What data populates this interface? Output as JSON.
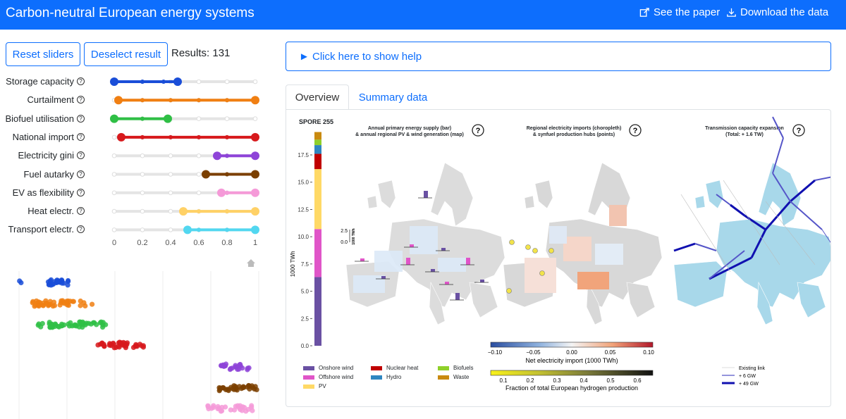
{
  "header": {
    "title": "Carbon-neutral European energy systems",
    "see_paper": "See the paper",
    "download": "Download the data"
  },
  "controls": {
    "reset_label": "Reset sliders",
    "deselect_label": "Deselect result",
    "results_text": "Results: 131"
  },
  "sliders": [
    {
      "label": "Storage capacity",
      "min": 0.0,
      "max": 0.45,
      "color": "#1a4ed8",
      "dots": [
        0,
        0.2,
        0.35
      ]
    },
    {
      "label": "Curtailment",
      "min": 0.03,
      "max": 1.0,
      "color": "#f07f12",
      "dots": [
        0.2,
        0.4,
        0.6,
        0.8
      ]
    },
    {
      "label": "Biofuel utilisation",
      "min": 0.0,
      "max": 0.38,
      "color": "#2fbf45",
      "dots": [
        0.2
      ]
    },
    {
      "label": "National import",
      "min": 0.05,
      "max": 1.0,
      "color": "#d7191c",
      "dots": [
        0.2,
        0.4,
        0.6,
        0.8
      ]
    },
    {
      "label": "Electricity gini",
      "min": 0.73,
      "max": 1.0,
      "color": "#8e44d8",
      "dots": [
        0.8
      ]
    },
    {
      "label": "Fuel autarky",
      "min": 0.65,
      "max": 1.0,
      "color": "#7b3f00",
      "dots": [
        0.8
      ]
    },
    {
      "label": "EV as flexibility",
      "min": 0.76,
      "max": 1.0,
      "color": "#f59ad8",
      "dots": [
        0.8
      ]
    },
    {
      "label": "Heat electr.",
      "min": 0.49,
      "max": 1.0,
      "color": "#ffd166",
      "dots": [
        0.6,
        0.8
      ]
    },
    {
      "label": "Transport electr.",
      "min": 0.52,
      "max": 1.0,
      "color": "#52d7f0",
      "dots": [
        0.6,
        0.8
      ]
    }
  ],
  "slider_ticks": [
    "0",
    "0.2",
    "0.4",
    "0.6",
    "0.8",
    "1"
  ],
  "help": {
    "label": "► Click here to show help"
  },
  "tabs": {
    "overview": "Overview",
    "summary": "Summary data"
  },
  "overview": {
    "spore": "SPORE 255",
    "caption1_l1": "Annual primary energy supply (bar)",
    "caption1_l2": "& annual regional PV & wind generation (map)",
    "caption2_l1": "Regional electricity imports (choropleth)",
    "caption2_l2": "& synfuel production hubs (points)",
    "caption3_l1": "Transmission capacity expansion",
    "caption3_l2": "(Total: + 1.6 TW)",
    "bar_ylabel": "1000 TWh",
    "bar_ticks": [
      "0.0",
      "2.5",
      "5.0",
      "7.5",
      "10.0",
      "12.5",
      "15.0",
      "17.5"
    ],
    "inset_label": "1000 TWh",
    "inset_ticks": [
      "0.0",
      "2.5"
    ],
    "import_ticks": [
      "-0.10",
      "-0.05",
      "0.00",
      "0.05",
      "0.10"
    ],
    "import_label": "Net electricity import (1000 TWh)",
    "h2_ticks": [
      "0.1",
      "0.2",
      "0.3",
      "0.4",
      "0.5",
      "0.6"
    ],
    "h2_label": "Fraction of total European hydrogen production",
    "legend": [
      {
        "label": "Onshore wind",
        "color": "#6a51a3"
      },
      {
        "label": "Offshore wind",
        "color": "#e055c8"
      },
      {
        "label": "PV",
        "color": "#ffd966"
      },
      {
        "label": "Nuclear heat",
        "color": "#c00000"
      },
      {
        "label": "Hydro",
        "color": "#2e86c1"
      },
      {
        "label": "Biofuels",
        "color": "#8fd02a"
      },
      {
        "label": "Waste",
        "color": "#c98a10"
      }
    ],
    "link_legend": [
      "Existing link",
      "+ 6 GW",
      "+ 49 GW"
    ]
  },
  "chart_data": {
    "type": "bar",
    "categories": [
      "SPORE 255"
    ],
    "series": [
      {
        "name": "Onshore wind",
        "values": [
          6.3
        ]
      },
      {
        "name": "Offshore wind",
        "values": [
          4.4
        ]
      },
      {
        "name": "PV",
        "values": [
          5.5
        ]
      },
      {
        "name": "Nuclear heat",
        "values": [
          1.4
        ]
      },
      {
        "name": "Hydro",
        "values": [
          0.8
        ]
      },
      {
        "name": "Biofuels",
        "values": [
          0.5
        ]
      },
      {
        "name": "Waste",
        "values": [
          0.7
        ]
      }
    ],
    "ylabel": "1000 TWh",
    "ylim": [
      0,
      17.5
    ]
  }
}
